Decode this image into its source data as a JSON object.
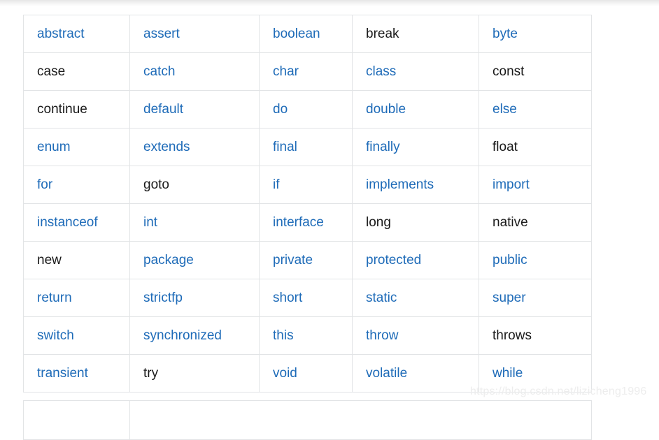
{
  "page": {
    "watermark": "https://blog.csdn.net/lizicheng1996",
    "link_color": "#1e6bb8",
    "plain_color": "#1a1a1a",
    "border_color": "#e2e4e6",
    "background_color": "#ffffff"
  },
  "keyword_table": {
    "columns": 5,
    "rows": [
      [
        {
          "text": "abstract",
          "style": "link"
        },
        {
          "text": "assert",
          "style": "link"
        },
        {
          "text": "boolean",
          "style": "link"
        },
        {
          "text": "break",
          "style": "plain"
        },
        {
          "text": "byte",
          "style": "link"
        }
      ],
      [
        {
          "text": "case",
          "style": "plain"
        },
        {
          "text": "catch",
          "style": "link"
        },
        {
          "text": "char",
          "style": "link"
        },
        {
          "text": "class",
          "style": "link"
        },
        {
          "text": "const",
          "style": "plain"
        }
      ],
      [
        {
          "text": "continue",
          "style": "plain"
        },
        {
          "text": "default",
          "style": "link"
        },
        {
          "text": "do",
          "style": "link"
        },
        {
          "text": "double",
          "style": "link"
        },
        {
          "text": "else",
          "style": "link"
        }
      ],
      [
        {
          "text": "enum",
          "style": "link"
        },
        {
          "text": "extends",
          "style": "link"
        },
        {
          "text": "final",
          "style": "link"
        },
        {
          "text": "finally",
          "style": "link"
        },
        {
          "text": "float",
          "style": "plain"
        }
      ],
      [
        {
          "text": "for",
          "style": "link"
        },
        {
          "text": "goto",
          "style": "plain"
        },
        {
          "text": "if",
          "style": "link"
        },
        {
          "text": "implements",
          "style": "link"
        },
        {
          "text": "import",
          "style": "link"
        }
      ],
      [
        {
          "text": "instanceof",
          "style": "link"
        },
        {
          "text": "int",
          "style": "link"
        },
        {
          "text": "interface",
          "style": "link"
        },
        {
          "text": "long",
          "style": "plain"
        },
        {
          "text": "native",
          "style": "plain"
        }
      ],
      [
        {
          "text": "new",
          "style": "plain"
        },
        {
          "text": "package",
          "style": "link"
        },
        {
          "text": "private",
          "style": "link"
        },
        {
          "text": "protected",
          "style": "link"
        },
        {
          "text": "public",
          "style": "link"
        }
      ],
      [
        {
          "text": "return",
          "style": "link"
        },
        {
          "text": "strictfp",
          "style": "link"
        },
        {
          "text": "short",
          "style": "link"
        },
        {
          "text": "static",
          "style": "link"
        },
        {
          "text": "super",
          "style": "link"
        }
      ],
      [
        {
          "text": "switch",
          "style": "link"
        },
        {
          "text": "synchronized",
          "style": "link"
        },
        {
          "text": "this",
          "style": "link"
        },
        {
          "text": "throw",
          "style": "link"
        },
        {
          "text": "throws",
          "style": "plain"
        }
      ],
      [
        {
          "text": "transient",
          "style": "link"
        },
        {
          "text": "try",
          "style": "plain"
        },
        {
          "text": "void",
          "style": "link"
        },
        {
          "text": "volatile",
          "style": "link"
        },
        {
          "text": "while",
          "style": "link"
        }
      ]
    ]
  },
  "next_table": {
    "rows": [
      [
        "",
        ""
      ]
    ]
  }
}
